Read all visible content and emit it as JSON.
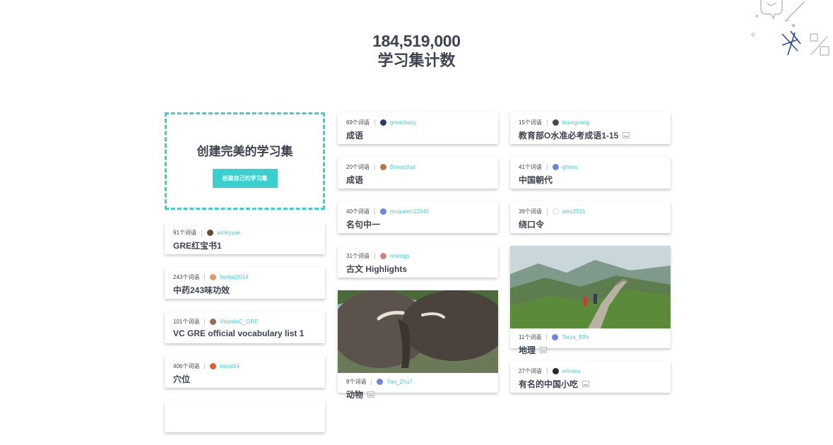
{
  "hero": {
    "count": "184,519,000",
    "label": "学习集计数"
  },
  "create": {
    "title": "创建完美的学习集",
    "button": "创建自己的学习集"
  },
  "colors": {
    "accent": "#3ccfcf",
    "text": "#3d4350"
  },
  "col1": [
    {
      "count": "91个词语",
      "user": "winkyyue",
      "title": "GRE红宝书1",
      "avatar": "#6b4a2f"
    },
    {
      "count": "243个词语",
      "user": "herbal2014",
      "title": "中药243味功效",
      "avatar": "#d8a070"
    },
    {
      "count": "101个词语",
      "user": "VitaminC_GRE",
      "title": "VC GRE official vocabulary list 1",
      "avatar": "#9a6a5a"
    },
    {
      "count": "406个词语",
      "user": "kecst14",
      "title": "穴位",
      "avatar": "#e05c3a"
    }
  ],
  "col2": [
    {
      "count": "69个词语",
      "user": "greatdaisy",
      "title": "成语",
      "avatar": "#2d3a70"
    },
    {
      "count": "20个词语",
      "user": "Bravezhui",
      "title": "成语",
      "avatar": "#b07a4a"
    },
    {
      "count": "40个词语",
      "user": "mcqueen12345",
      "title": "名句中一",
      "avatar": "#6f86d6"
    },
    {
      "count": "31个词语",
      "user": "nheirigs",
      "title": "古文 Highlights",
      "avatar": "#c88a7a"
    },
    {
      "count": "8个词语",
      "user": "Yan_Zhu7",
      "title": "动物",
      "avatar": "#6f86d6",
      "image": "elephant-photo"
    }
  ],
  "col3": [
    {
      "count": "15个词语",
      "user": "lixueguang",
      "title": "教育部O水准必考成语1-15",
      "avatar": "#4a4a4a",
      "image_icon": true
    },
    {
      "count": "41个词语",
      "user": "ghexu",
      "title": "中国朝代",
      "avatar": "#6f86d6"
    },
    {
      "count": "39个词语",
      "user": "alex3531",
      "title": "绕口令",
      "avatar": "#e8e8e8"
    },
    {
      "count": "11个词语",
      "user": "Terza_Effe",
      "title": "地理",
      "avatar": "#6f86d6",
      "image": "great-wall-photo",
      "image_icon": true
    },
    {
      "count": "27个词语",
      "user": "ericaxu",
      "title": "有名的中国小吃",
      "avatar": "#2a2a2a",
      "image_icon": true
    }
  ]
}
